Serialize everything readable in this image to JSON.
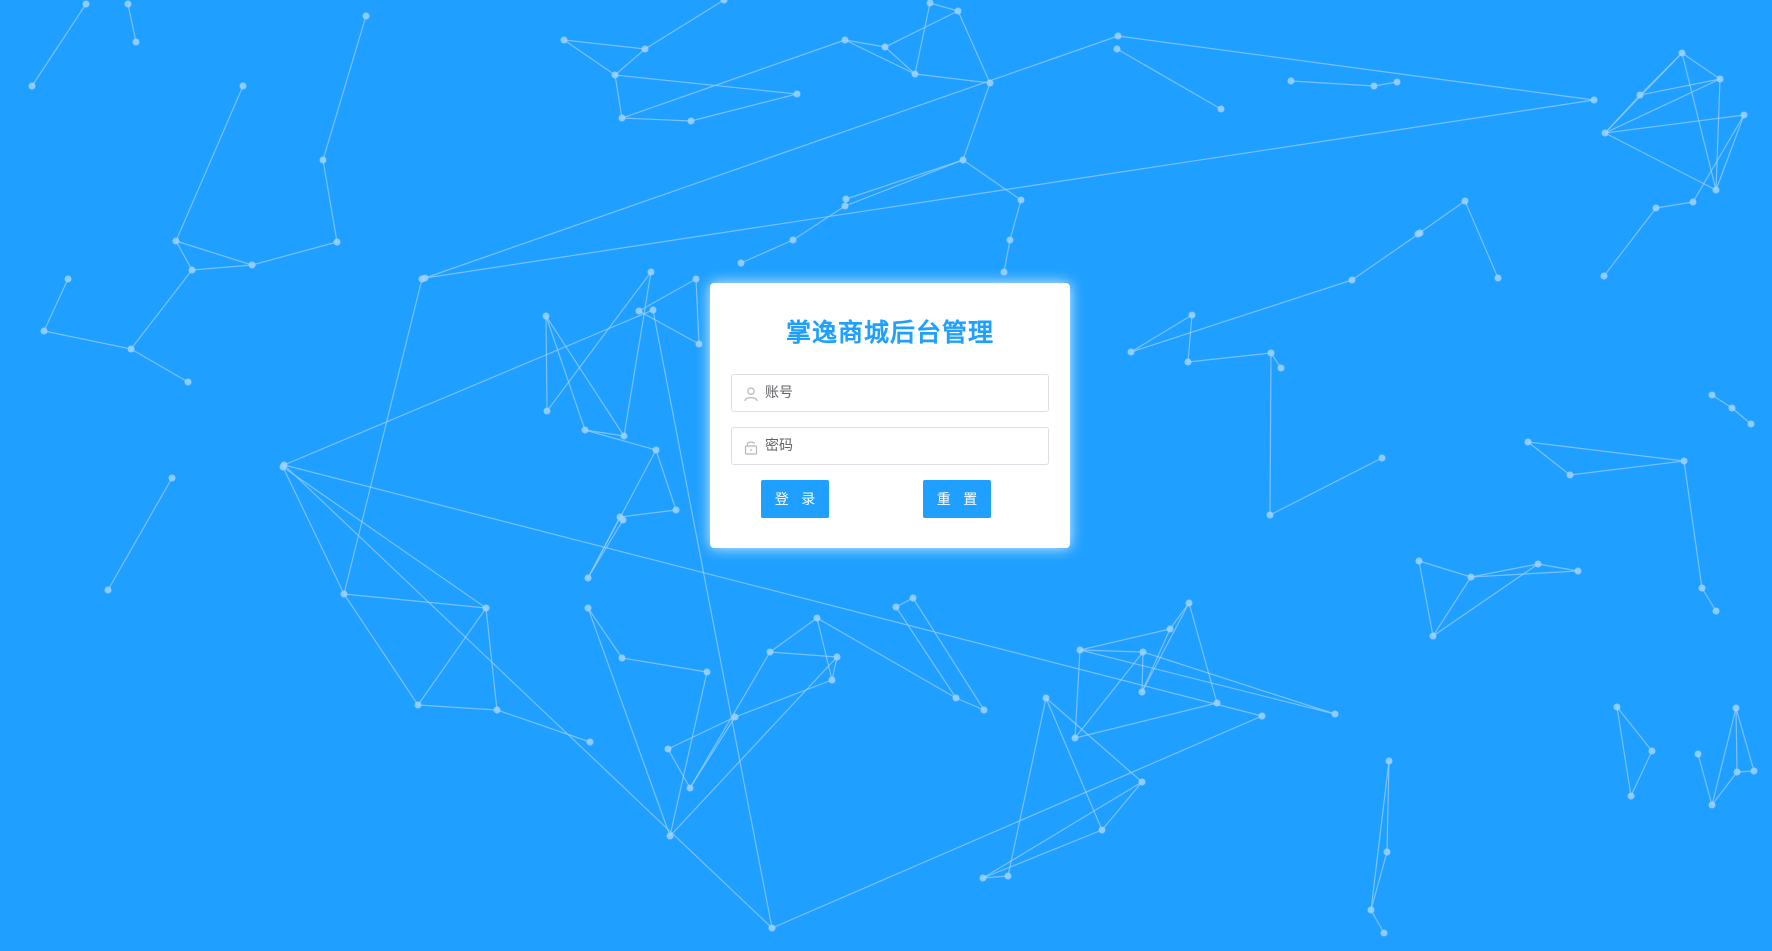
{
  "login": {
    "title": "掌逸商城后台管理",
    "username": {
      "placeholder": "账号",
      "value": "",
      "icon": "user-icon"
    },
    "password": {
      "placeholder": "密码",
      "value": "",
      "icon": "lock-icon"
    },
    "login_label": "登 录",
    "reset_label": "重 置"
  },
  "colors": {
    "background": "#1f9fff",
    "accent": "#1f9fff",
    "particle": "#9fd2ff"
  }
}
